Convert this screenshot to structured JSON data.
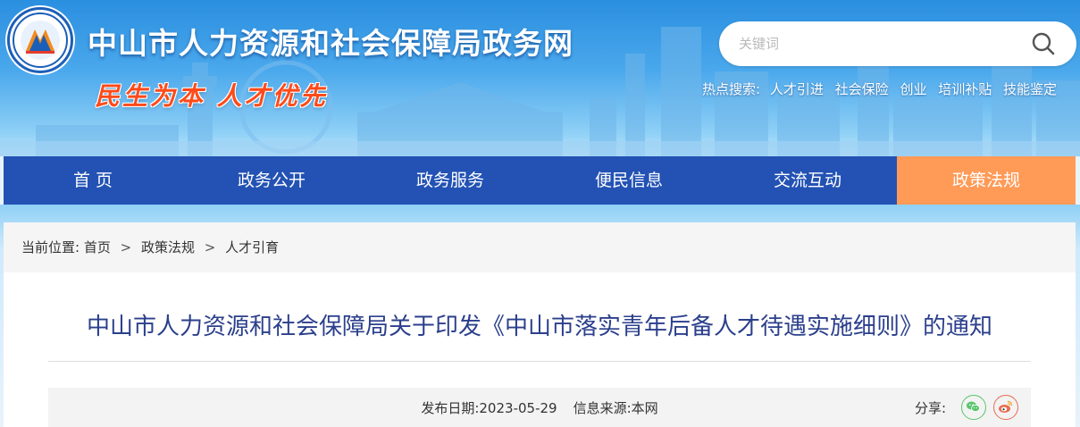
{
  "site": {
    "title": "中山市人力资源和社会保障局政务网",
    "slogan": "民生为本 人才优先"
  },
  "search": {
    "placeholder": "关键词",
    "hot_label": "热点搜索:",
    "hot_links": [
      "人才引进",
      "社会保险",
      "创业",
      "培训补贴",
      "技能鉴定"
    ]
  },
  "nav": {
    "items": [
      "首 页",
      "政务公开",
      "政务服务",
      "便民信息",
      "交流互动",
      "政策法规"
    ],
    "active_index": 5
  },
  "breadcrumb": {
    "label": "当前位置:",
    "items": [
      "首页",
      "政策法规",
      "人才引育"
    ],
    "separator": ">"
  },
  "article": {
    "title": "中山市人力资源和社会保障局关于印发《中山市落实青年后备人才待遇实施细则》的通知",
    "date_label": "发布日期:",
    "date": "2023-05-29",
    "source_label": "信息来源:",
    "source": "本网",
    "share_label": "分享:"
  },
  "colors": {
    "nav_bg": "#2352b4",
    "nav_active": "#ff9a57",
    "title_color": "#2b3f8c",
    "slogan_color": "#ff4a1a"
  },
  "icons": [
    "search-icon",
    "wechat-icon",
    "weibo-icon",
    "logo-emblem"
  ]
}
